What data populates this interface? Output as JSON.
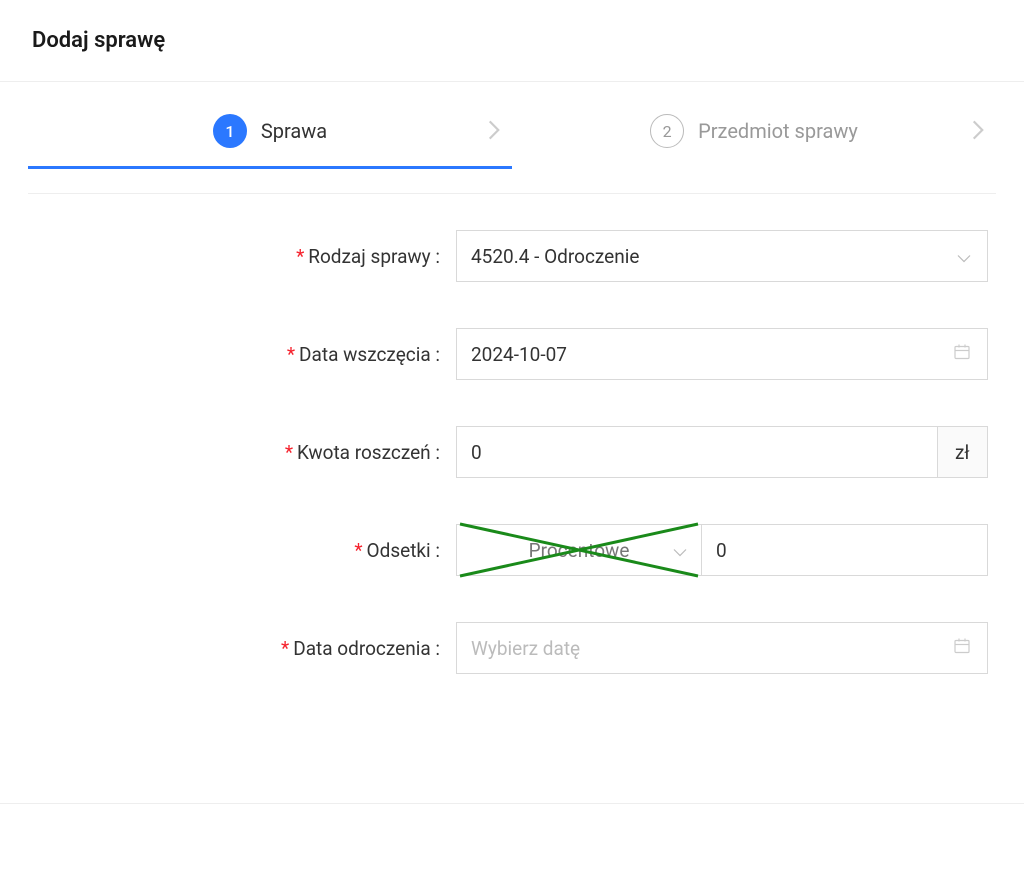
{
  "page": {
    "title": "Dodaj sprawę"
  },
  "stepper": {
    "steps": [
      {
        "number": "1",
        "label": "Sprawa",
        "active": true
      },
      {
        "number": "2",
        "label": "Przedmiot sprawy",
        "active": false
      }
    ]
  },
  "form": {
    "rodzaj_sprawy": {
      "label": "Rodzaj sprawy :",
      "value": "4520.4 - Odroczenie"
    },
    "data_wszczecia": {
      "label": "Data wszczęcia :",
      "value": "2024-10-07"
    },
    "kwota_roszczen": {
      "label": "Kwota roszczeń :",
      "value": "0",
      "suffix": "zł"
    },
    "odsetki": {
      "label": "Odsetki :",
      "type_value": "Procentowe",
      "amount": "0"
    },
    "data_odroczenia": {
      "label": "Data odroczenia :",
      "placeholder": "Wybierz datę"
    }
  }
}
